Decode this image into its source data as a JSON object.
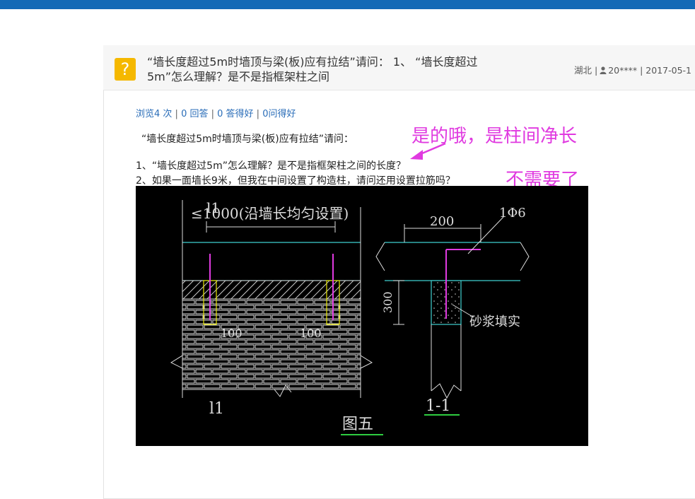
{
  "question": {
    "title_line1": "“墙长度超过5m时墙顶与梁(板)应有拉结”请问： 1、 “墙长度超过",
    "title_line2": "5m”怎么理解？是不是指框架柱之间",
    "region": "湖北",
    "user": "20****",
    "date": "2017-05-1"
  },
  "stats": {
    "views": "浏览4 次",
    "answers": "0 回答",
    "good": "0 答得好",
    "asks": "0问得好"
  },
  "body": {
    "intro": "“墙长度超过5m时墙顶与梁(板)应有拉结”请问：",
    "q1": "1、“墙长度超过5m”怎么理解？是不是指框架柱之间的长度？",
    "q2": "2、如果一面墙长9米，但我在中间设置了构造柱，请问还用设置拉筋吗？"
  },
  "annotations": {
    "answer1": "是的哦，是柱间净长",
    "answer2": "不需要了",
    "color": "#e03ae0"
  },
  "drawing": {
    "note_top": "≤1000(沿墙长均匀设置)",
    "label_l1": "l1",
    "dim_100_left": "100",
    "dim_100_right": "100",
    "section_l1": "l1",
    "caption": "图五",
    "dim_200": "200",
    "rebar": "1Φ6",
    "dim_300": "300",
    "mortar": "砂浆填实",
    "section_11": "1-1"
  },
  "icons": {
    "question": "question-mark-icon",
    "user": "user-icon"
  }
}
